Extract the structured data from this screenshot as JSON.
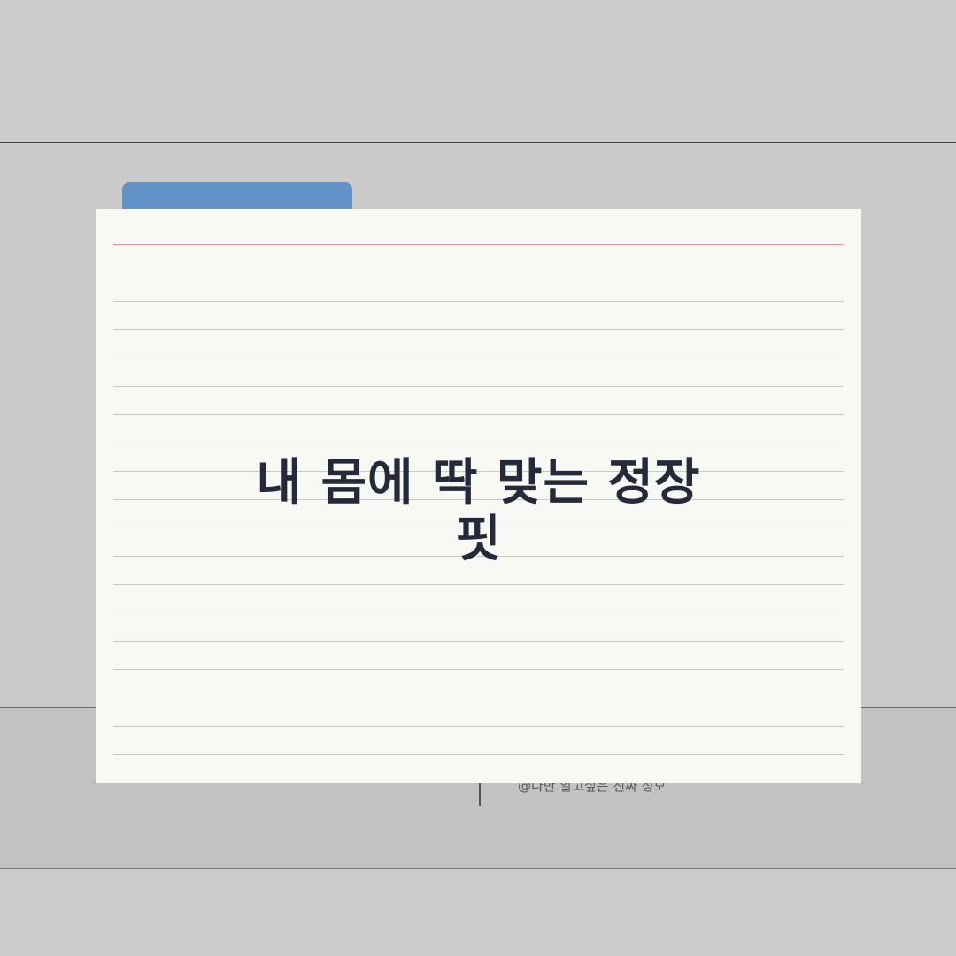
{
  "card": {
    "title": "내 몸에 딱 맞는 정장 핏"
  },
  "footer": {
    "handle": "@나만 알고싶은 진짜 정보"
  },
  "colors": {
    "background": "#cccccc",
    "tab_accent": "#6392c8",
    "card_paper": "#f8f8f4",
    "margin_rule": "#d99a96",
    "title_text": "#252a3b"
  }
}
